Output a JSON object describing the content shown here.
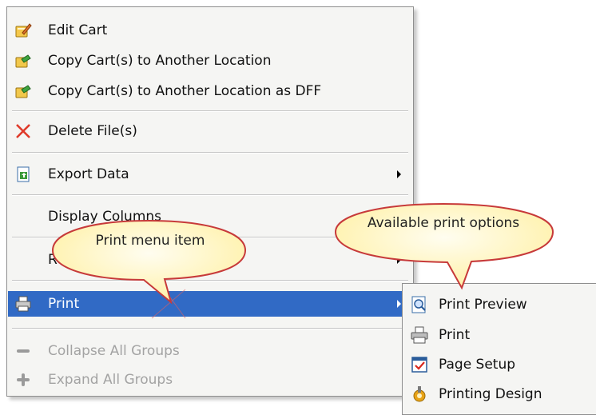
{
  "menu": {
    "items": [
      {
        "label": "Edit Cart",
        "icon": "edit-cart-icon"
      },
      {
        "label": "Copy Cart(s) to Another Location",
        "icon": "copy-cart-icon"
      },
      {
        "label": "Copy Cart(s) to Another Location as DFF",
        "icon": "copy-cart-dff-icon"
      },
      {
        "label": "Delete File(s)",
        "icon": "delete-x-icon"
      },
      {
        "label": "Export Data",
        "icon": "export-data-icon",
        "submenu": true
      },
      {
        "label": "Display Columns",
        "submenu": true
      },
      {
        "label": "Reports",
        "submenu": true
      },
      {
        "label": "Print",
        "icon": "printer-icon",
        "submenu": true,
        "selected": true
      },
      {
        "label": "Collapse All Groups",
        "icon": "minus-icon",
        "disabled": true
      },
      {
        "label": "Expand All Groups",
        "icon": "plus-icon",
        "disabled": true
      }
    ]
  },
  "submenu": {
    "items": [
      {
        "label": "Print Preview",
        "icon": "print-preview-icon"
      },
      {
        "label": "Print",
        "icon": "printer-icon"
      },
      {
        "label": "Page Setup",
        "icon": "page-setup-icon"
      },
      {
        "label": "Printing Design",
        "icon": "printing-design-icon"
      }
    ]
  },
  "callouts": {
    "menu_item": "Print menu item",
    "options": "Available print options"
  },
  "colors": {
    "highlight": "#316ac5",
    "menu_bg": "#f5f5f3",
    "callout_fill": "#fff6c2",
    "callout_stroke": "#c73a3a"
  }
}
